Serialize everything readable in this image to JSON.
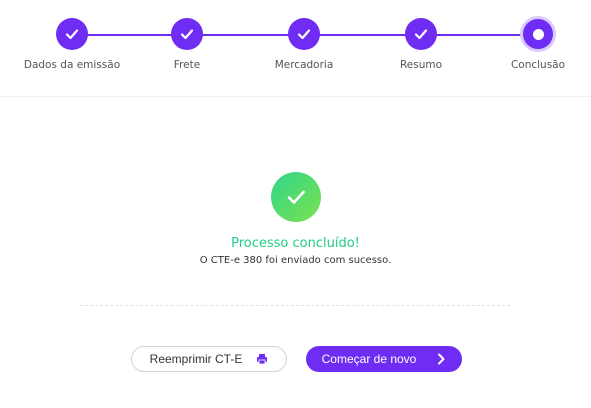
{
  "stepper": {
    "steps": [
      {
        "label": "Dados da emissão",
        "state": "done"
      },
      {
        "label": "Frete",
        "state": "done"
      },
      {
        "label": "Mercadoria",
        "state": "done"
      },
      {
        "label": "Resumo",
        "state": "done"
      },
      {
        "label": "Conclusão",
        "state": "current"
      }
    ],
    "accent_color": "#6f2cf3"
  },
  "success": {
    "title": "Processo concluído!",
    "message": "O CTE-e 380 foi enviado com sucesso.",
    "color": "#1fcf84"
  },
  "actions": {
    "reprint_label": "Reemprimir CT-E",
    "restart_label": "Começar de novo"
  }
}
